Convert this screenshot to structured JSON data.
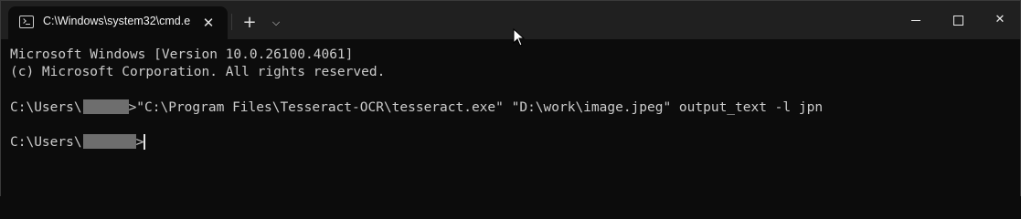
{
  "window": {
    "tab_title": "C:\\Windows\\system32\\cmd.e",
    "tab_close_glyph": "✕",
    "new_tab_glyph": "+",
    "dropdown_glyph": "⌵",
    "close_glyph": "✕"
  },
  "terminal": {
    "line1": "Microsoft Windows [Version 10.0.26100.4061]",
    "line2": "(c) Microsoft Corporation. All rights reserved.",
    "prompt_prefix": "C:\\Users\\",
    "command": ">\"C:\\Program Files\\Tesseract-OCR\\tesseract.exe\" \"D:\\work\\image.jpeg\" output_text -l jpn",
    "prompt_suffix": ">"
  },
  "colors": {
    "background": "#0c0c0c",
    "titlebar": "#202020",
    "text": "#cccccc",
    "redaction": "#6e6e6e"
  },
  "icons": [
    "cmd-icon",
    "close-icon",
    "plus-icon",
    "chevron-down-icon",
    "minimize-icon",
    "maximize-icon",
    "mouse-pointer-icon"
  ]
}
